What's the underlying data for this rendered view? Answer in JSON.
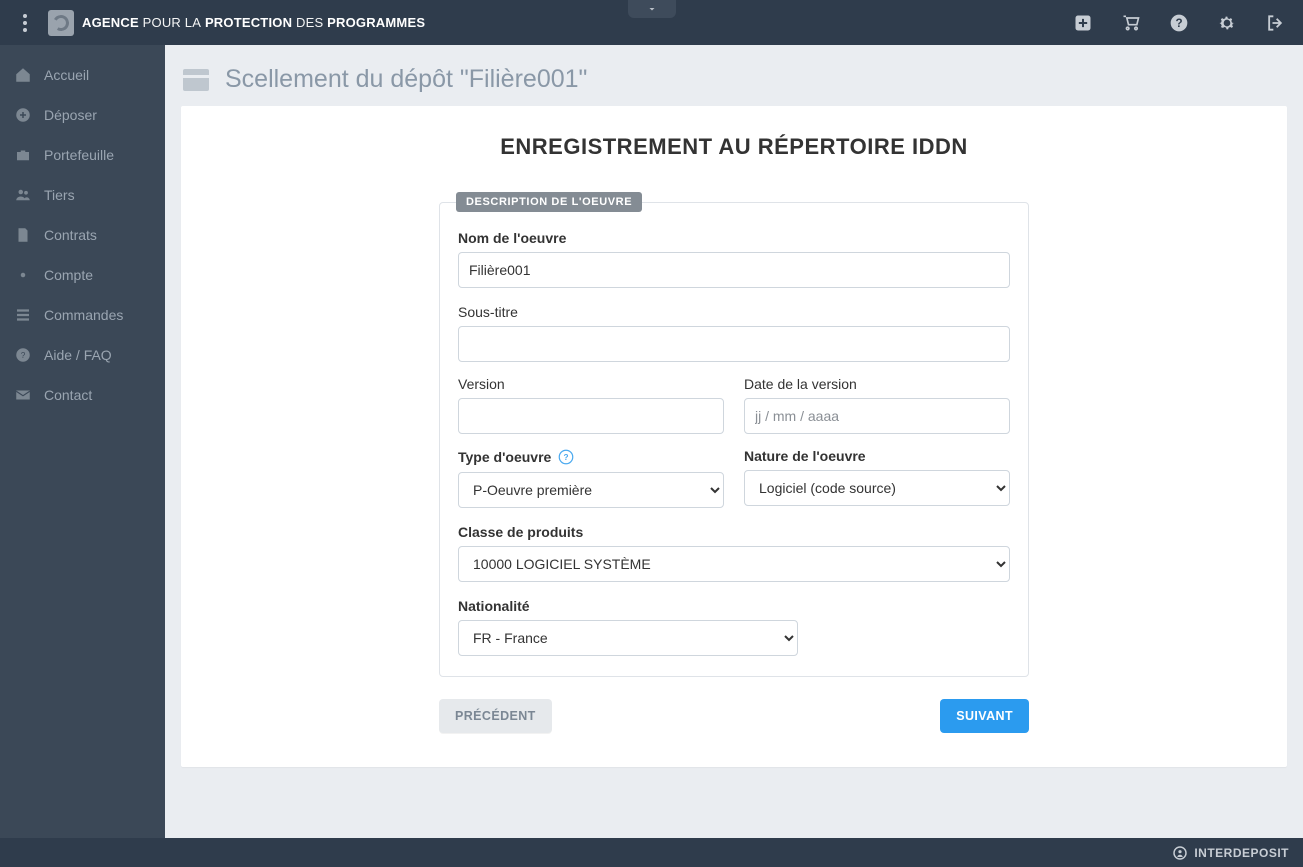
{
  "brand": {
    "bold1": "AGENCE",
    "light1": "POUR LA",
    "bold2": "PROTECTION",
    "light2": "DES",
    "bold3": "PROGRAMMES"
  },
  "sidebar": {
    "items": [
      {
        "label": "Accueil"
      },
      {
        "label": "Déposer"
      },
      {
        "label": "Portefeuille"
      },
      {
        "label": "Tiers"
      },
      {
        "label": "Contrats"
      },
      {
        "label": "Compte"
      },
      {
        "label": "Commandes"
      },
      {
        "label": "Aide / FAQ"
      },
      {
        "label": "Contact"
      }
    ]
  },
  "page": {
    "title": "Scellement du dépôt \"Filière001\"",
    "heading": "ENREGISTREMENT AU RÉPERTOIRE IDDN"
  },
  "form": {
    "legend": "DESCRIPTION DE L'OEUVRE",
    "name_label": "Nom de l'oeuvre",
    "name_value": "Filière001",
    "subtitle_label": "Sous-titre",
    "subtitle_value": "",
    "version_label": "Version",
    "version_value": "",
    "date_label": "Date de la version",
    "date_placeholder": "jj / mm / aaaa",
    "type_label": "Type d'oeuvre",
    "type_value": "P-Oeuvre première",
    "nature_label": "Nature de l'oeuvre",
    "nature_value": "Logiciel (code source)",
    "class_label": "Classe de produits",
    "class_value": "10000 LOGICIEL SYSTÈME",
    "nationality_label": "Nationalité",
    "nationality_value": "FR - France"
  },
  "actions": {
    "prev": "PRÉCÉDENT",
    "next": "SUIVANT"
  },
  "footer": {
    "brand": "INTERDEPOSIT"
  }
}
